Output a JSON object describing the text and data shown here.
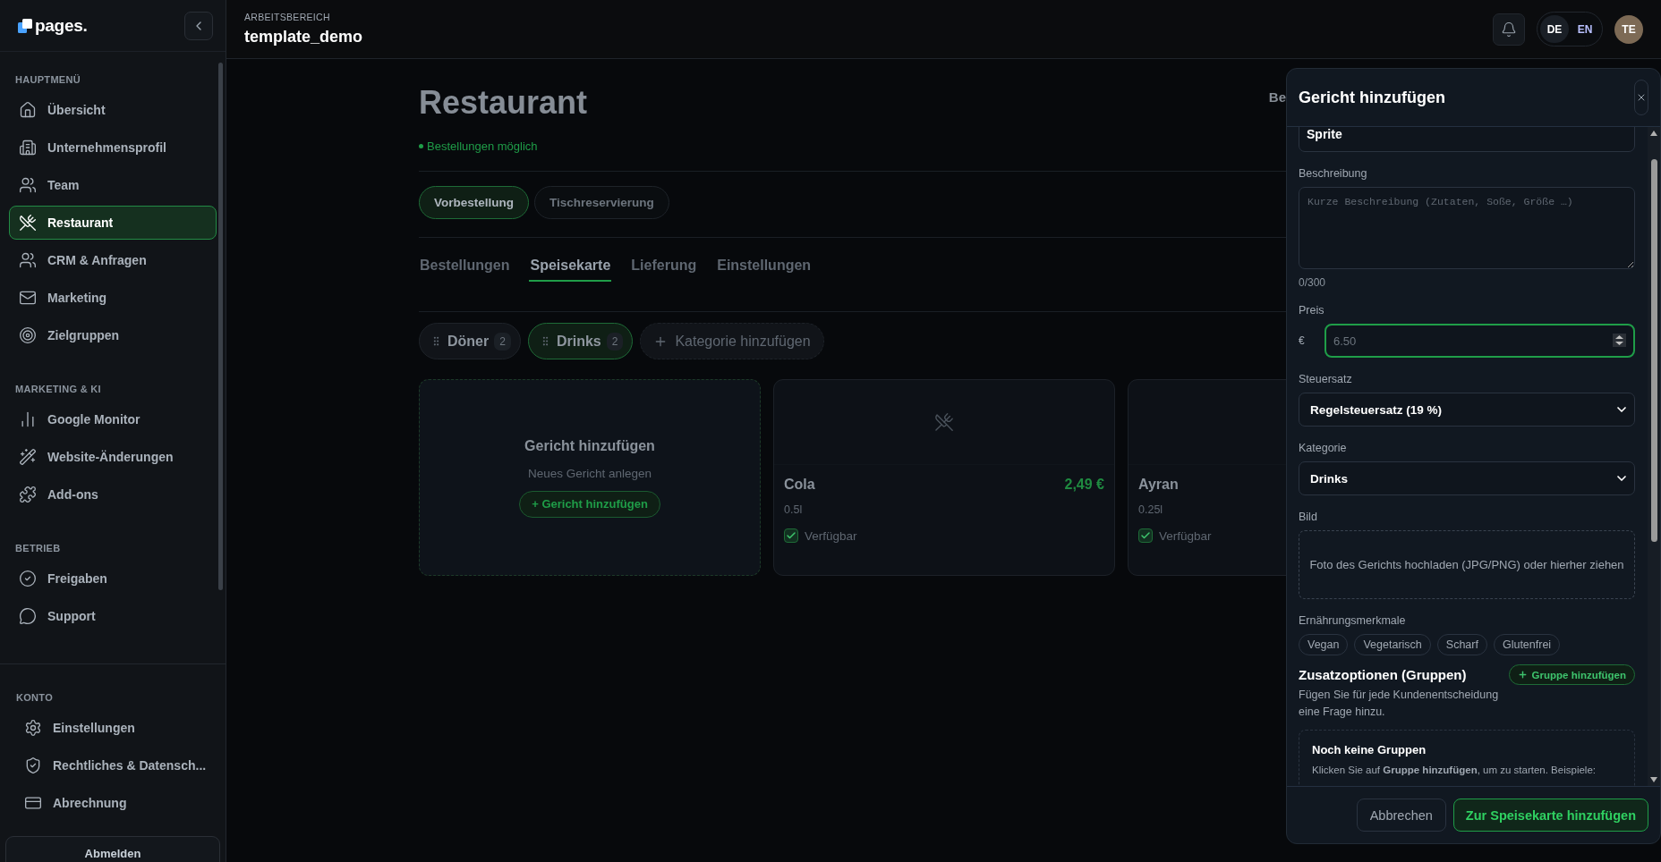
{
  "app": {
    "logo": "pages."
  },
  "sidebar": {
    "sections": [
      {
        "title": "HAUPTMENÜ",
        "items": [
          {
            "label": "Übersicht",
            "selected": false
          },
          {
            "label": "Unternehmensprofil",
            "selected": false
          },
          {
            "label": "Team",
            "selected": false
          },
          {
            "label": "Restaurant",
            "selected": true
          },
          {
            "label": "CRM & Anfragen",
            "selected": false
          },
          {
            "label": "Marketing",
            "selected": false
          },
          {
            "label": "Zielgruppen",
            "selected": false
          }
        ]
      },
      {
        "title": "MARKETING & KI",
        "items": [
          {
            "label": "Google Monitor",
            "selected": false
          },
          {
            "label": "Website-Änderungen",
            "selected": false
          },
          {
            "label": "Add-ons",
            "selected": false
          }
        ]
      },
      {
        "title": "BETRIEB",
        "items": [
          {
            "label": "Freigaben",
            "selected": false
          },
          {
            "label": "Support",
            "selected": false
          }
        ]
      }
    ],
    "account": {
      "title": "KONTO",
      "items": [
        {
          "label": "Einstellungen",
          "selected": false
        },
        {
          "label": "Rechtliches & Datensch...",
          "selected": false
        },
        {
          "label": "Abrechnung",
          "selected": false
        }
      ]
    },
    "logout": "Abmelden"
  },
  "header": {
    "eyebrow": "ARBEITSBEREICH",
    "workspace": "template_demo",
    "languages": [
      {
        "label": "DE",
        "selected": true
      },
      {
        "label": "EN",
        "selected": false
      }
    ],
    "avatar": "TE"
  },
  "page": {
    "title": "Restaurant",
    "status": "Bestellungen möglich",
    "stat_label": "Be",
    "modes": [
      {
        "label": "Vorbestellung",
        "selected": true
      },
      {
        "label": "Tischreservierung",
        "selected": false
      }
    ],
    "tabs": [
      {
        "label": "Bestellungen",
        "selected": false
      },
      {
        "label": "Speisekarte",
        "selected": true
      },
      {
        "label": "Lieferung",
        "selected": false
      },
      {
        "label": "Einstellungen",
        "selected": false
      }
    ],
    "categories": [
      {
        "label": "Döner",
        "count": "2",
        "selected": false
      },
      {
        "label": "Drinks",
        "count": "2",
        "selected": true
      }
    ],
    "add_category": "Kategorie hinzufügen",
    "add_card": {
      "title": "Gericht hinzufügen",
      "subtitle": "Neues Gericht anlegen",
      "button": "+ Gericht hinzufügen"
    },
    "dishes": [
      {
        "name": "Cola",
        "price": "2,49 €",
        "size": "0.5l",
        "available": true,
        "availability": "Verfügbar"
      },
      {
        "name": "Ayran",
        "size": "0.25l",
        "available": true,
        "availability": "Verfügbar"
      }
    ]
  },
  "dialog": {
    "title": "Gericht hinzufügen",
    "name_value": "Sprite",
    "description_label": "Beschreibung",
    "description_placeholder": "Kurze Beschreibung (Zutaten, Soße, Größe …)",
    "counter": "0/300",
    "price_label": "Preis",
    "currency": "€",
    "price_placeholder": "6.50",
    "tax_label": "Steuersatz",
    "tax_value": "Regelsteuersatz (19 %)",
    "category_label": "Kategorie",
    "category_value": "Drinks",
    "image_label": "Bild",
    "image_hint": "Foto des Gerichts hochladen (JPG/PNG) oder hierher ziehen",
    "diet_label": "Ernährungsmerkmale",
    "diet_tags": [
      {
        "label": "Vegan",
        "selected": false
      },
      {
        "label": "Vegetarisch",
        "selected": false
      },
      {
        "label": "Scharf",
        "selected": false
      },
      {
        "label": "Glutenfrei",
        "selected": false
      }
    ],
    "groups_title": "Zusatzoptionen (Gruppen)",
    "add_group": "Gruppe hinzufügen",
    "groups_description": "Fügen Sie für jede Kundenentscheidung eine Frage hinzu.",
    "empty_title": "Noch keine Gruppen",
    "empty_text": "Klicken Sie auf **Gruppe hinzufügen**, um zu starten. Beispiele:",
    "cancel": "Abbrechen",
    "submit": "Zur Speisekarte hinzufügen"
  }
}
